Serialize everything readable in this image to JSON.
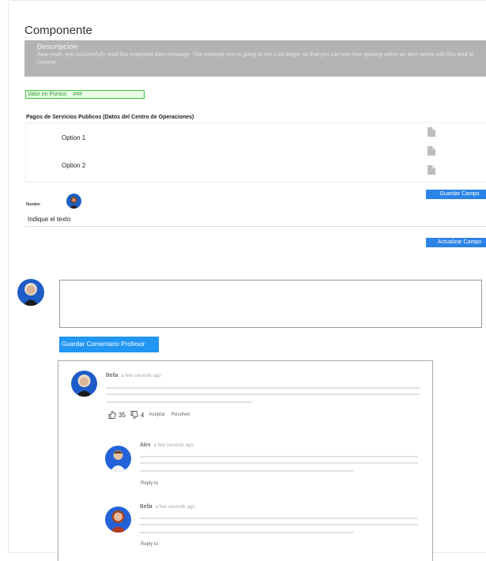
{
  "component": {
    "title": "Componente"
  },
  "alert": {
    "heading": "Descripción",
    "body": "Aww yeah, you successfully read this important alert message. This example text is going to run a bit longer so that you can see how spacing within an alert works with this kind of content."
  },
  "points": {
    "label": "Valor en Puntos",
    "value": "###"
  },
  "payments": {
    "title": "Pagos de Servicios Publicos (Datos del Centro de Operaciones)",
    "options": [
      "Option 1",
      "Option 2"
    ]
  },
  "buttons": {
    "guardar_campo": "Guardar Campo",
    "actualizar_campo": "Actualizar Campo",
    "guardar_comentario": "Guardar Comentario Profesor"
  },
  "name_field": {
    "label": "Nombre",
    "text": "Indique el texto"
  },
  "comments": [
    {
      "author": "Bella",
      "time": "a few seconds ago",
      "likes": "35",
      "dislikes": "4",
      "accept": "Aceptar",
      "resolve": "Resolver"
    },
    {
      "author": "Alex",
      "time": "a few seconds ago",
      "reply": "Reply to"
    },
    {
      "author": "Bella",
      "time": "a few seconds ago",
      "reply": "Reply to"
    }
  ],
  "colors": {
    "primary_button": "#2b83e6",
    "comment_button": "#2196f3",
    "alert_bg": "#b3b3b3",
    "points_border": "#3cc43c"
  }
}
